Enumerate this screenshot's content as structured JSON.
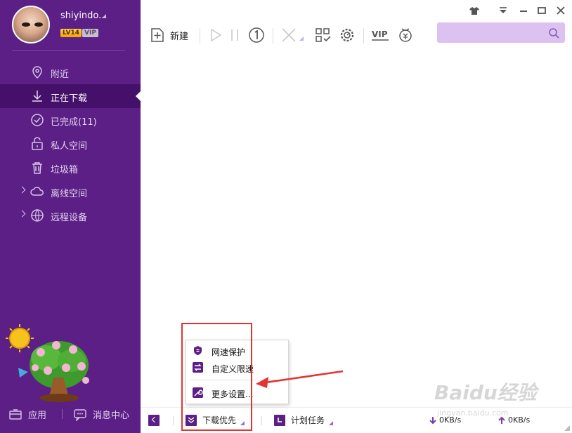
{
  "user": {
    "name": "shiyindo...",
    "level": "LV14",
    "vip": "VIP"
  },
  "sidebar": {
    "items": [
      {
        "label": "附近",
        "icon": "location-pin-icon",
        "active": false,
        "expandable": false
      },
      {
        "label": "正在下载",
        "icon": "download-arrow-icon",
        "active": true,
        "expandable": false
      },
      {
        "label": "已完成(11)",
        "icon": "check-circle-icon",
        "active": false,
        "expandable": false
      },
      {
        "label": "私人空间",
        "icon": "lock-icon",
        "active": false,
        "expandable": false
      },
      {
        "label": "垃圾箱",
        "icon": "trash-icon",
        "active": false,
        "expandable": false
      },
      {
        "label": "离线空间",
        "icon": "cloud-icon",
        "active": false,
        "expandable": true
      },
      {
        "label": "远程设备",
        "icon": "globe-icon",
        "active": false,
        "expandable": true
      }
    ],
    "footer": {
      "apps_label": "应用",
      "messages_label": "消息中心"
    }
  },
  "toolbar": {
    "new_label": "新建",
    "search_placeholder": ""
  },
  "bottom": {
    "priority_label": "下载优先",
    "schedule_label": "计划任务",
    "download_speed": "0KB/s",
    "upload_speed": "0KB/s"
  },
  "popup_menu": {
    "items": [
      {
        "label": "网速保护",
        "icon": "shield-icon"
      },
      {
        "label": "自定义限速",
        "icon": "swap-arrows-icon"
      },
      {
        "label": "更多设置...",
        "icon": "wrench-icon"
      }
    ]
  },
  "watermark": {
    "brand": "Baidu经验",
    "sub": "jingyan.baidu.com"
  },
  "colors": {
    "sidebar": "#5b1f86",
    "sidebar_active": "#45106a",
    "search_bg": "#dcc2f0",
    "annotation": "#e3342f"
  }
}
